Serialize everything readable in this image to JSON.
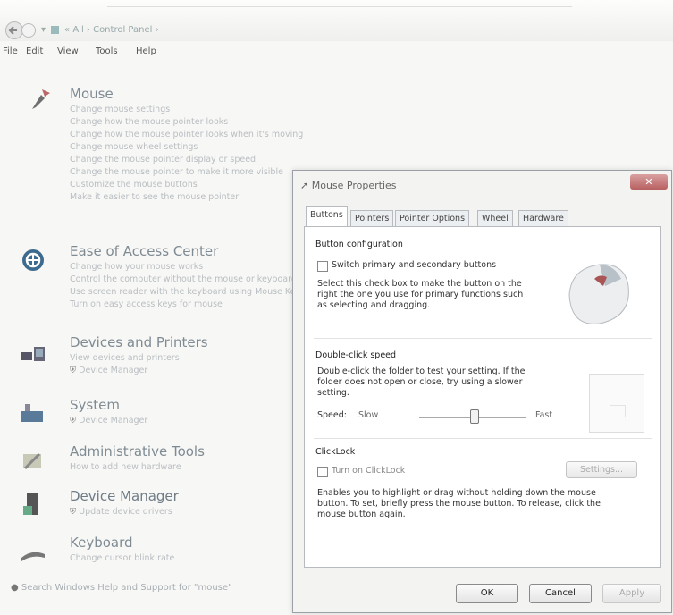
{
  "addressbar": {
    "path": "« All › Control Panel ›"
  },
  "menu": {
    "file": "File",
    "edit": "Edit",
    "view": "View",
    "tools": "Tools",
    "help": "Help"
  },
  "mouse": {
    "title": "Mouse",
    "links": [
      "Change mouse settings",
      "Change how the mouse pointer looks",
      "Change how the mouse pointer looks when it's moving",
      "Change mouse wheel settings",
      "Change the mouse pointer display or speed",
      "Change the mouse pointer to make it more visible",
      "Customize the mouse buttons",
      "Make it easier to see the mouse pointer"
    ]
  },
  "ease": {
    "title": "Ease of Access Center",
    "links": [
      "Change how your mouse works",
      "Control the computer without the mouse or keyboard",
      "Use screen reader with the keyboard using Mouse Keys",
      "Turn on easy access keys for mouse"
    ]
  },
  "devices": {
    "title": "Devices and Printers",
    "links": [
      "View devices and printers",
      "Device Manager"
    ]
  },
  "system": {
    "title": "System",
    "links": [
      "Device Manager"
    ]
  },
  "admin": {
    "title": "Administrative Tools",
    "links": [
      "How to add new hardware"
    ]
  },
  "devmgr": {
    "title": "Device Manager",
    "links": [
      "Update device drivers"
    ]
  },
  "keyboard": {
    "title": "Keyboard",
    "links": [
      "Change cursor blink rate"
    ]
  },
  "footer": {
    "text": "Search Windows Help and Support for \"mouse\""
  },
  "dialog": {
    "title": "Mouse Properties",
    "close": "✕",
    "tabs": [
      "Buttons",
      "Pointers",
      "Pointer Options",
      "Wheel",
      "Hardware"
    ],
    "button_config": {
      "title": "Button configuration",
      "checkbox": "Switch primary and secondary buttons",
      "desc1": "Select this check box to make the button on the",
      "desc2": "right the one you use for primary functions such",
      "desc3": "as selecting and dragging."
    },
    "dblclick": {
      "title": "Double-click speed",
      "desc1": "Double-click the folder to test your setting.  If the",
      "desc2": "folder does not open or close, try using a slower",
      "desc3": "setting.",
      "speed": "Speed:",
      "slow": "Slow",
      "fast": "Fast"
    },
    "clicklock": {
      "title": "ClickLock",
      "checkbox": "Turn on ClickLock",
      "settings": "Settings...",
      "desc1": "Enables you to highlight or drag without holding down the mouse",
      "desc2": "button. To set, briefly press the mouse button. To release, click the",
      "desc3": "mouse button again."
    },
    "ok": "OK",
    "cancel": "Cancel",
    "apply": "Apply"
  }
}
